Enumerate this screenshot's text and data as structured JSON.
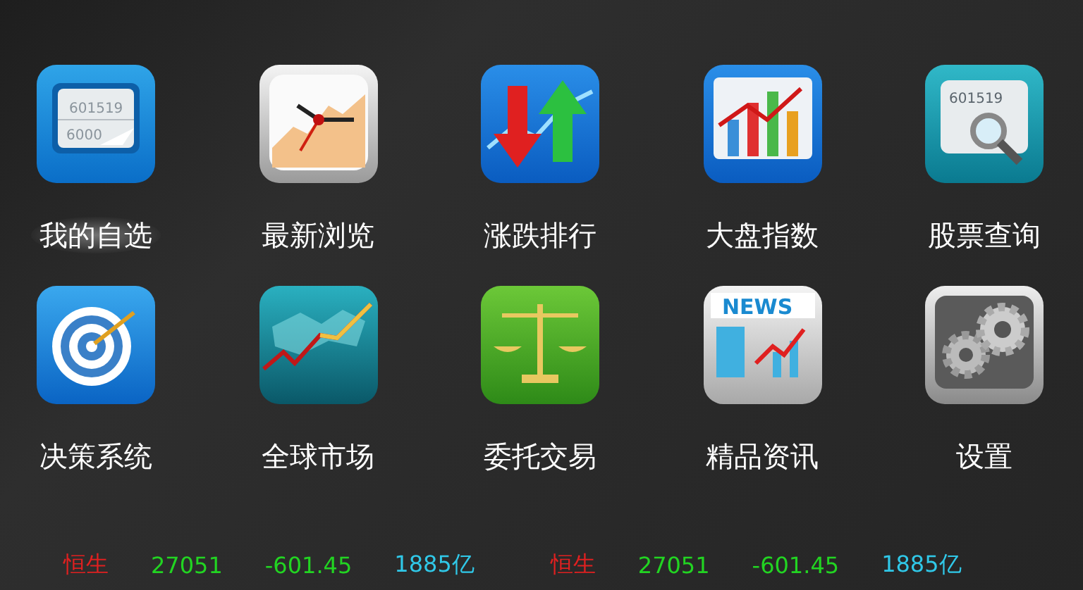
{
  "menu": [
    {
      "label": "我的自选",
      "kind": "watchlist",
      "icon_text": [
        "601519",
        "6000"
      ],
      "selected": true
    },
    {
      "label": "最新浏览",
      "kind": "clock",
      "selected": false
    },
    {
      "label": "涨跌排行",
      "kind": "updown",
      "selected": false
    },
    {
      "label": "大盘指数",
      "kind": "chart",
      "selected": false
    },
    {
      "label": "股票查询",
      "kind": "search",
      "icon_text": [
        "601519"
      ],
      "selected": false
    },
    {
      "label": "决策系统",
      "kind": "target",
      "selected": false
    },
    {
      "label": "全球市场",
      "kind": "globe",
      "selected": false
    },
    {
      "label": "委托交易",
      "kind": "scale",
      "selected": false
    },
    {
      "label": "精品资讯",
      "kind": "news",
      "icon_text": [
        "NEWS"
      ],
      "selected": false
    },
    {
      "label": "设置",
      "kind": "gears",
      "selected": false
    }
  ],
  "ticker": [
    {
      "kind": "name",
      "text": "恒生"
    },
    {
      "kind": "price",
      "text": "27051"
    },
    {
      "kind": "change",
      "text": "-601.45"
    },
    {
      "kind": "volume",
      "text": "1885亿"
    },
    {
      "kind": "name",
      "text": "恒生"
    },
    {
      "kind": "price",
      "text": "27051"
    },
    {
      "kind": "change",
      "text": "-601.45"
    },
    {
      "kind": "volume",
      "text": "1885亿"
    }
  ]
}
